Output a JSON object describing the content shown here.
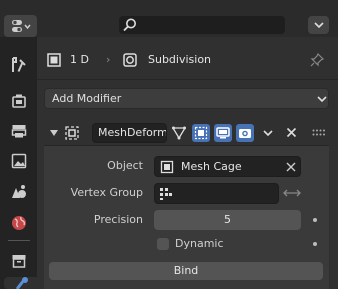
{
  "header": {
    "object_name": "1 D",
    "modifier_tab_label": "Subdivision",
    "search_placeholder": ""
  },
  "add_modifier_label": "Add Modifier",
  "modifier": {
    "name": "MeshDeform",
    "fields": {
      "object_label": "Object",
      "object_value": "Mesh Cage",
      "vertex_group_label": "Vertex Group",
      "vertex_group_value": "",
      "precision_label": "Precision",
      "precision_value": "5",
      "dynamic_label": "Dynamic",
      "dynamic_checked": false
    },
    "bind_label": "Bind"
  },
  "colors": {
    "accent_blue": "#4772b3",
    "background": "#303030",
    "field": "#222222"
  }
}
